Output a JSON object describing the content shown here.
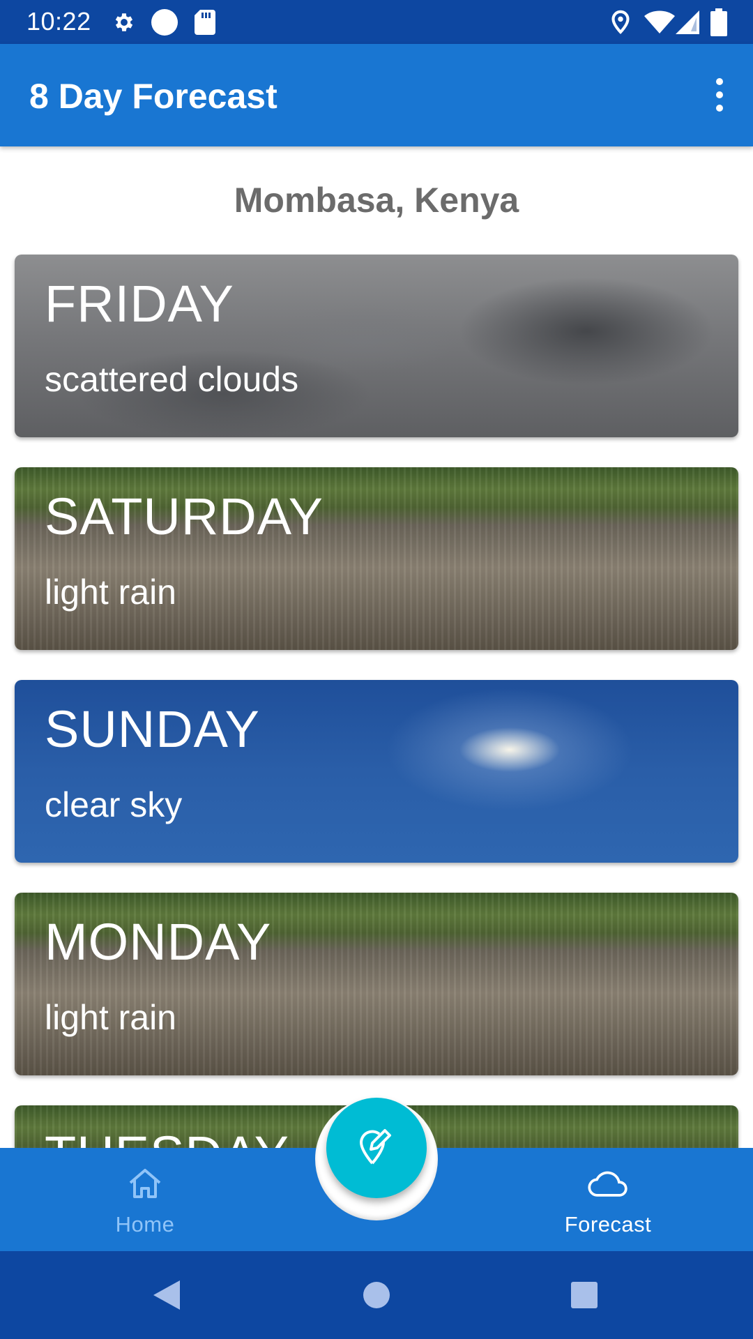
{
  "status_bar": {
    "time": "10:22",
    "left_icons": [
      "settings-icon",
      "circle-icon",
      "sd-card-icon"
    ],
    "right_icons": [
      "location-icon",
      "wifi-icon",
      "signal-icon",
      "battery-icon"
    ]
  },
  "app_bar": {
    "title": "8 Day Forecast",
    "menu_icon": "more-vert-icon"
  },
  "location": "Mombasa, Kenya",
  "forecast": [
    {
      "day": "FRIDAY",
      "description": "scattered clouds",
      "background": "clouds"
    },
    {
      "day": "SATURDAY",
      "description": "light rain",
      "background": "rain"
    },
    {
      "day": "SUNDAY",
      "description": "clear sky",
      "background": "sky"
    },
    {
      "day": "MONDAY",
      "description": "light rain",
      "background": "rain"
    },
    {
      "day": "TUESDAY",
      "description": "",
      "background": "rain"
    }
  ],
  "bottom_nav": {
    "items": [
      {
        "label": "Home",
        "icon": "home-icon",
        "active": false
      },
      {
        "label": "Forecast",
        "icon": "cloud-icon",
        "active": true
      }
    ],
    "fab_icon": "edit-location-icon"
  },
  "colors": {
    "status_bar": "#0d47a1",
    "app_bar": "#1976d2",
    "fab": "#00bcd4",
    "inactive_nav": "#90c4f8"
  }
}
